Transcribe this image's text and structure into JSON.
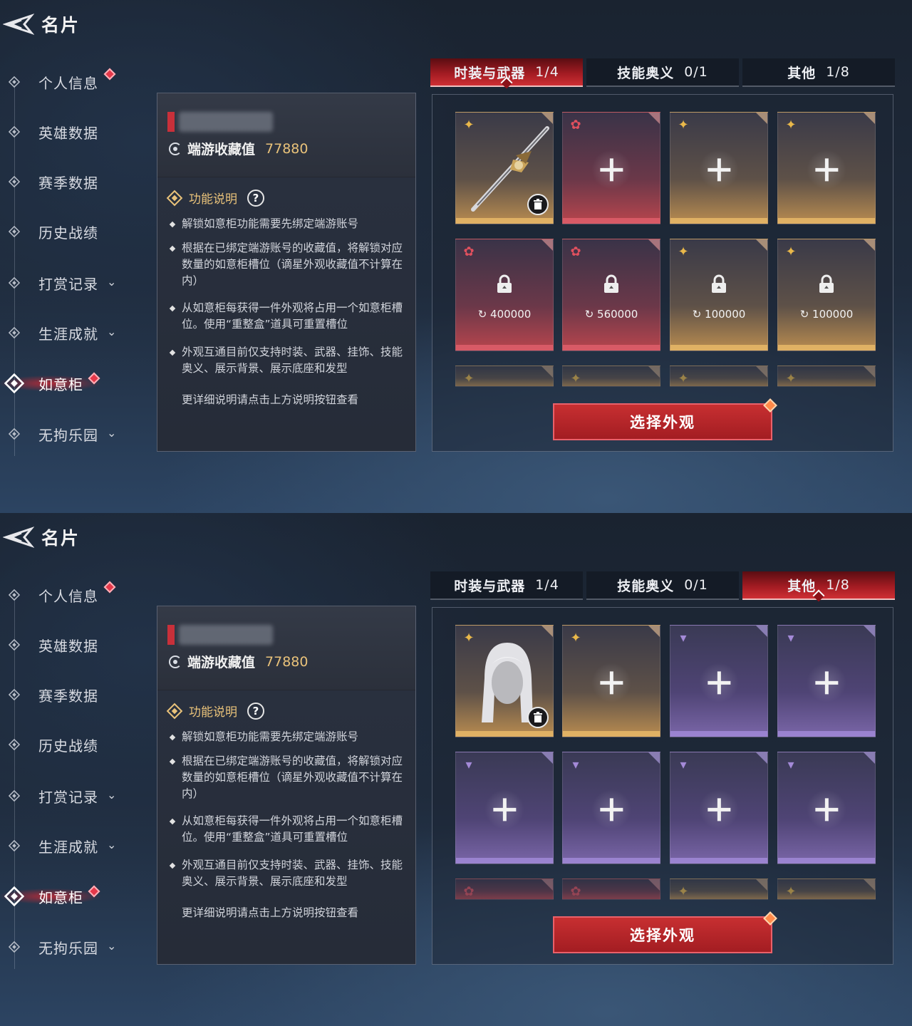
{
  "screens": [
    {
      "header": {
        "title": "名片"
      },
      "sidebar": {
        "items": [
          {
            "label": "个人信息"
          },
          {
            "label": "英雄数据"
          },
          {
            "label": "赛季数据"
          },
          {
            "label": "历史战绩"
          },
          {
            "label": "打赏记录"
          },
          {
            "label": "生涯成就"
          },
          {
            "label": "如意柜"
          },
          {
            "label": "无拘乐园"
          }
        ]
      },
      "info": {
        "collect_label": "端游收藏值",
        "collect_value": "77880",
        "func_title": "功能说明",
        "help": "?",
        "bullets": [
          "解锁如意柜功能需要先绑定端游账号",
          "根据在已绑定端游账号的收藏值，将解锁对应数量的如意柜槽位（谪星外观收藏值不计算在内）",
          "从如意柜每获得一件外观将占用一个如意柜槽位。使用“重整盒”道具可重置槽位",
          "外观互通目前仅支持时装、武器、挂饰、技能奥义、展示背景、展示底座和发型"
        ],
        "more": "更详细说明请点击上方说明按钮查看"
      },
      "tabs": [
        {
          "label": "时装与武器",
          "count": "1/4",
          "active": true
        },
        {
          "label": "技能奥义",
          "count": "0/1",
          "active": false
        },
        {
          "label": "其他",
          "count": "1/8",
          "active": false
        }
      ],
      "slots": [
        {
          "rarity": "gold",
          "state": "item",
          "item": "weapon"
        },
        {
          "rarity": "red",
          "state": "empty"
        },
        {
          "rarity": "gold",
          "state": "empty"
        },
        {
          "rarity": "gold",
          "state": "empty"
        },
        {
          "rarity": "red",
          "state": "locked",
          "cost": "400000"
        },
        {
          "rarity": "red",
          "state": "locked",
          "cost": "560000"
        },
        {
          "rarity": "gold",
          "state": "locked",
          "cost": "100000"
        },
        {
          "rarity": "gold",
          "state": "locked",
          "cost": "100000"
        }
      ],
      "select_button": "选择外观"
    },
    {
      "header": {
        "title": "名片"
      },
      "sidebar": {
        "items": [
          {
            "label": "个人信息"
          },
          {
            "label": "英雄数据"
          },
          {
            "label": "赛季数据"
          },
          {
            "label": "历史战绩"
          },
          {
            "label": "打赏记录"
          },
          {
            "label": "生涯成就"
          },
          {
            "label": "如意柜"
          },
          {
            "label": "无拘乐园"
          }
        ]
      },
      "info": {
        "collect_label": "端游收藏值",
        "collect_value": "77880",
        "func_title": "功能说明",
        "help": "?",
        "bullets": [
          "解锁如意柜功能需要先绑定端游账号",
          "根据在已绑定端游账号的收藏值，将解锁对应数量的如意柜槽位（谪星外观收藏值不计算在内）",
          "从如意柜每获得一件外观将占用一个如意柜槽位。使用“重整盒”道具可重置槽位",
          "外观互通目前仅支持时装、武器、挂饰、技能奥义、展示背景、展示底座和发型"
        ],
        "more": "更详细说明请点击上方说明按钮查看"
      },
      "tabs": [
        {
          "label": "时装与武器",
          "count": "1/4",
          "active": false
        },
        {
          "label": "技能奥义",
          "count": "0/1",
          "active": false
        },
        {
          "label": "其他",
          "count": "1/8",
          "active": true
        }
      ],
      "slots": [
        {
          "rarity": "gold",
          "state": "item",
          "item": "hair"
        },
        {
          "rarity": "gold",
          "state": "empty"
        },
        {
          "rarity": "purple",
          "state": "empty"
        },
        {
          "rarity": "purple",
          "state": "empty"
        },
        {
          "rarity": "purple",
          "state": "empty"
        },
        {
          "rarity": "purple",
          "state": "empty"
        },
        {
          "rarity": "purple",
          "state": "empty"
        },
        {
          "rarity": "purple",
          "state": "empty"
        }
      ],
      "select_button": "选择外观"
    }
  ],
  "colors": {
    "accent_red": "#c72f31",
    "gold_text": "#e9c27a",
    "gold_rarity": "#e0b164",
    "red_rarity": "#d85a66",
    "purple_rarity": "#9a83d0"
  }
}
